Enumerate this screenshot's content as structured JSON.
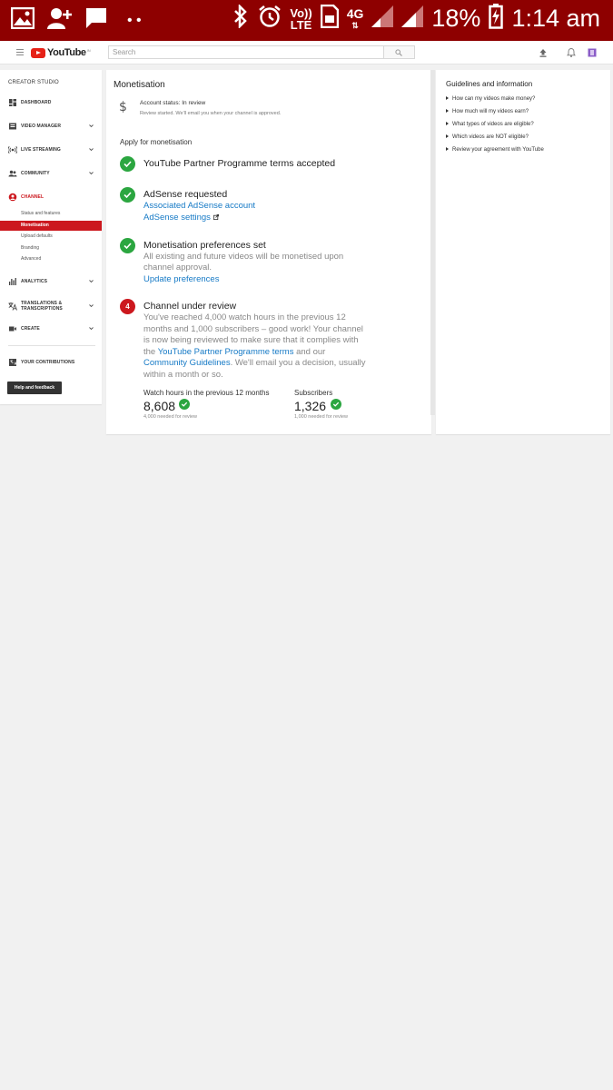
{
  "status_bar": {
    "battery": "18%",
    "time": "1:14 am",
    "network": "4G",
    "volte_top": "Vo))",
    "volte_bottom": "LTE",
    "notification_dots": "• •"
  },
  "header": {
    "logo_text": "YouTube",
    "logo_country": "IN",
    "search_placeholder": "Search"
  },
  "sidebar": {
    "title": "CREATOR STUDIO",
    "items": [
      {
        "label": "DASHBOARD",
        "icon": "dashboard-icon"
      },
      {
        "label": "VIDEO MANAGER",
        "icon": "video-manager-icon"
      },
      {
        "label": "LIVE STREAMING",
        "icon": "live-streaming-icon"
      },
      {
        "label": "COMMUNITY",
        "icon": "community-icon"
      },
      {
        "label": "CHANNEL",
        "icon": "channel-icon"
      },
      {
        "label": "ANALYTICS",
        "icon": "analytics-icon"
      },
      {
        "label_line1": "TRANSLATIONS &",
        "label_line2": "TRANSCRIPTIONS",
        "icon": "translate-icon"
      },
      {
        "label": "CREATE",
        "icon": "create-icon"
      },
      {
        "label": "YOUR CONTRIBUTIONS",
        "icon": "contributions-icon"
      }
    ],
    "channel_sub": [
      "Status and features",
      "Monetisation",
      "Upload defaults",
      "Branding",
      "Advanced"
    ],
    "help_button": "Help and feedback",
    "active_color": "#cc181e"
  },
  "main": {
    "title": "Monetisation",
    "account_status": "Account status: In review",
    "account_sub": "Review started. We'll email you when your channel is approved.",
    "apply_title": "Apply for monetisation",
    "step1": {
      "title": "YouTube Partner Programme terms accepted"
    },
    "step2": {
      "title": "AdSense requested",
      "link1": "Associated AdSense account",
      "link2": "AdSense settings"
    },
    "step3": {
      "title": "Monetisation preferences set",
      "line1": "All existing and future videos will be monetised upon",
      "line2": "channel approval.",
      "link": "Update preferences"
    },
    "step4": {
      "number": "4",
      "title": "Channel under review",
      "line1": "You've reached 4,000 watch hours in the previous 12",
      "line2": "months and 1,000 subscribers – good work! Your channel",
      "line3": "is now being reviewed to make sure that it complies with",
      "line4_pre": "the ",
      "line4_link": "YouTube Partner Programme terms",
      "line4_post": " and our",
      "line5_link": "Community Guidelines",
      "line5_post": ". We'll email you a decision, usually",
      "line6": "within a month or so."
    },
    "stats": {
      "watch_label": "Watch hours in the previous 12 months",
      "watch_value": "8,608",
      "watch_needed": "4,000 needed for review",
      "subs_label": "Subscribers",
      "subs_value": "1,326",
      "subs_needed": "1,000 needed for review"
    },
    "success_color": "#2ba640",
    "link_color": "#167ac6"
  },
  "guidelines": {
    "title": "Guidelines and information",
    "items": [
      "How can my videos make money?",
      "How much will my videos earn?",
      "What types of videos are eligible?",
      "Which videos are NOT eligible?",
      "Review your agreement with YouTube"
    ]
  }
}
